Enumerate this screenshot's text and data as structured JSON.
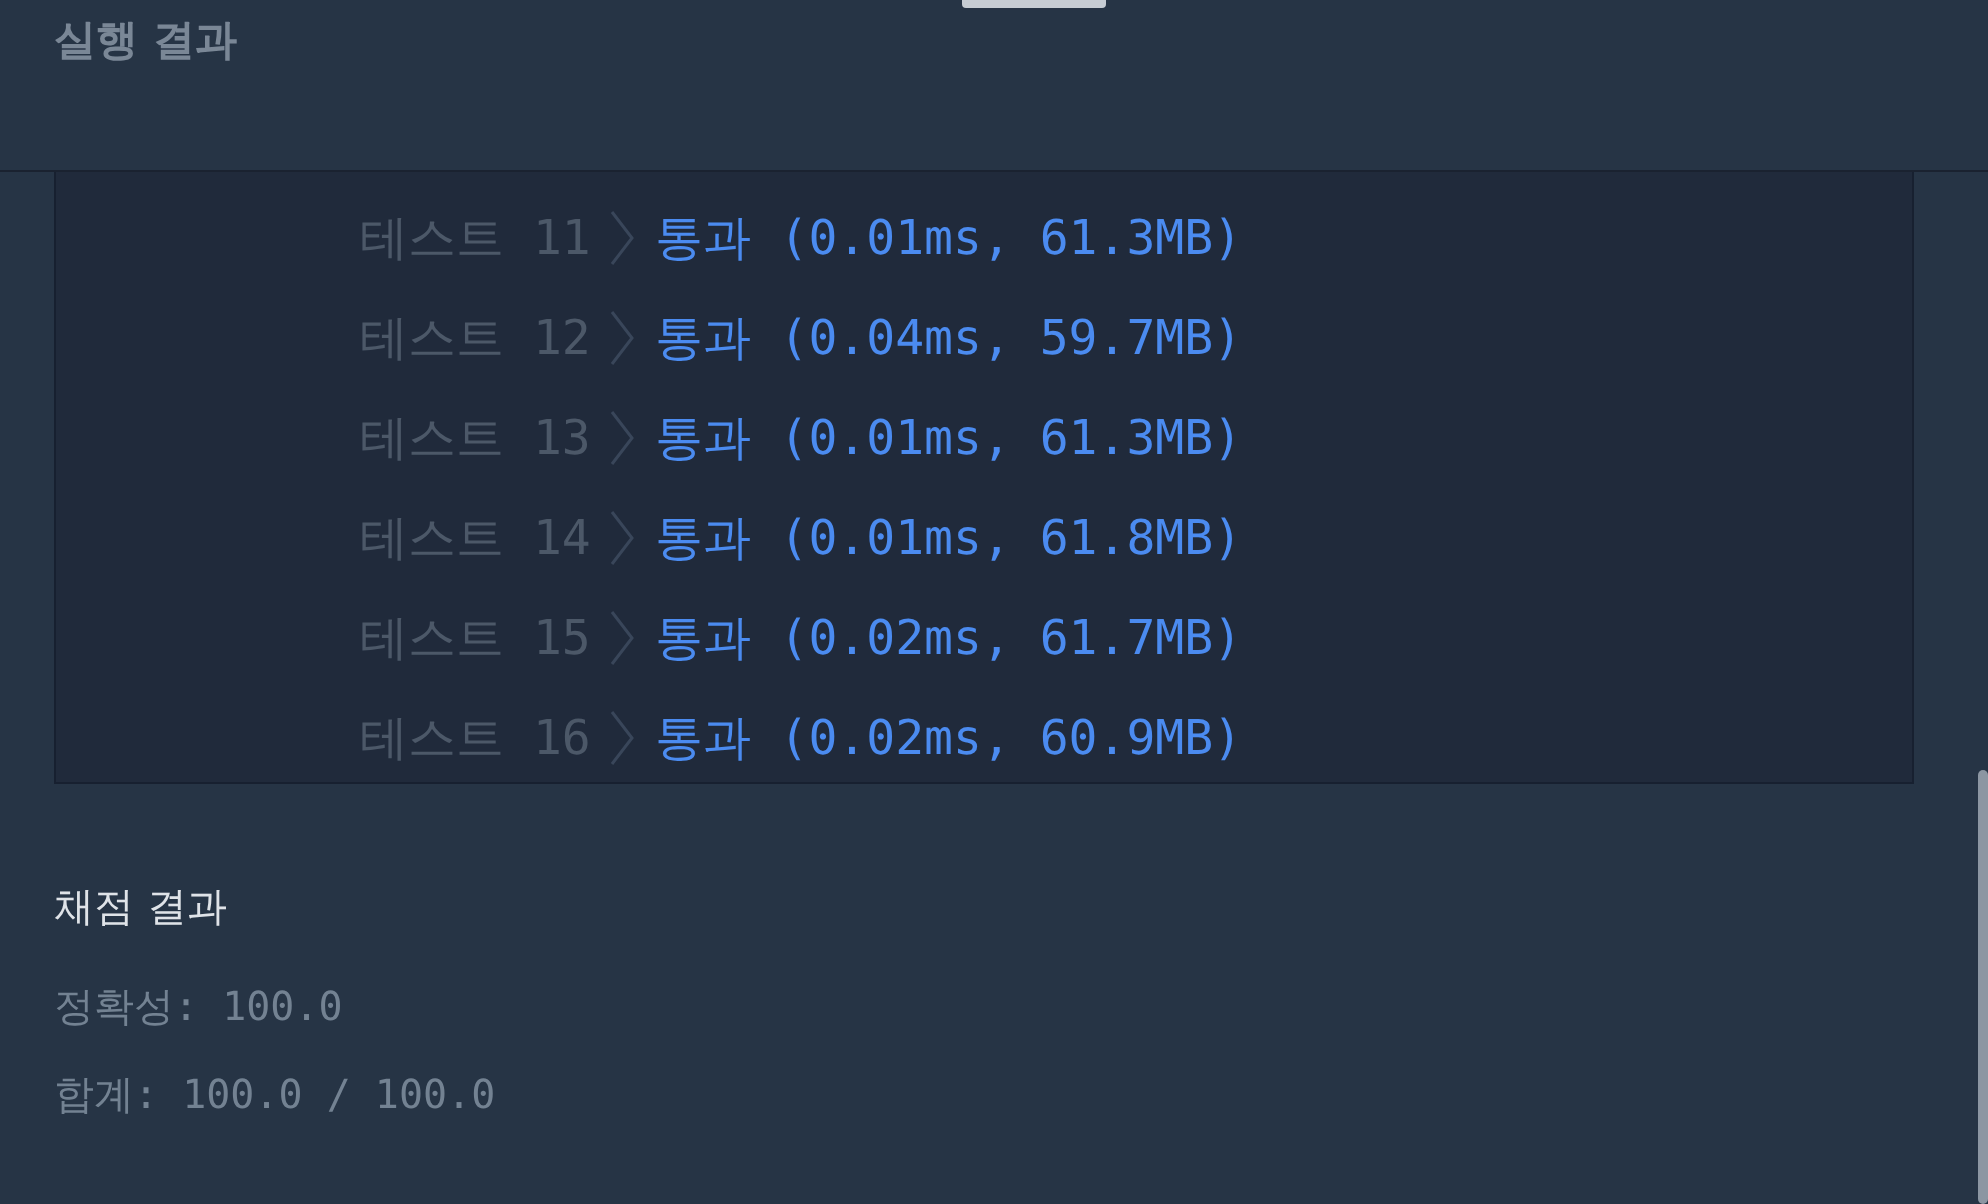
{
  "header": {
    "title": "실행 결과"
  },
  "tests": [
    {
      "label": "테스트 11",
      "result": "통과 (0.01ms, 61.3MB)"
    },
    {
      "label": "테스트 12",
      "result": "통과 (0.04ms, 59.7MB)"
    },
    {
      "label": "테스트 13",
      "result": "통과 (0.01ms, 61.3MB)"
    },
    {
      "label": "테스트 14",
      "result": "통과 (0.01ms, 61.8MB)"
    },
    {
      "label": "테스트 15",
      "result": "통과 (0.02ms, 61.7MB)"
    },
    {
      "label": "테스트 16",
      "result": "통과 (0.02ms, 60.9MB)"
    }
  ],
  "grading": {
    "title": "채점 결과",
    "lines": [
      "정확성: 100.0",
      "합계: 100.0 / 100.0"
    ]
  }
}
